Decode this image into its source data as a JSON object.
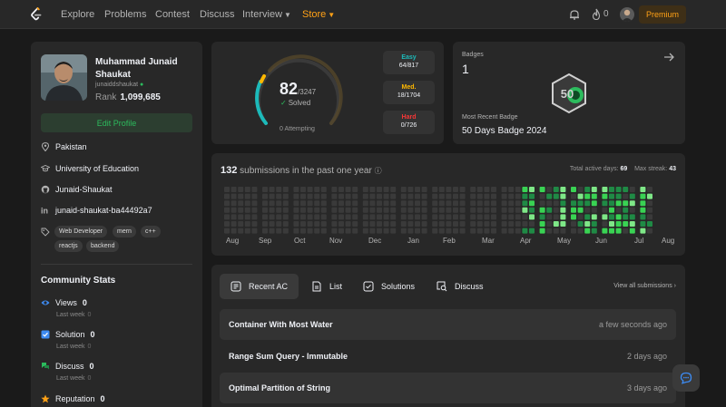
{
  "nav": {
    "items": [
      "Explore",
      "Problems",
      "Contest",
      "Discuss",
      "Interview",
      "Store"
    ],
    "streak": "0",
    "premium": "Premium"
  },
  "profile": {
    "name": "Muhammad Junaid Shaukat",
    "username": "junaiddshaukat",
    "rank_label": "Rank",
    "rank": "1,099,685",
    "edit_label": "Edit Profile",
    "location": "Pakistan",
    "school": "University of Education",
    "github": "Junaid-Shaukat",
    "linkedin": "junaid-shaukat-ba44492a7",
    "tags": [
      "Web Developer",
      "mern",
      "c++",
      "reactjs",
      "backend"
    ]
  },
  "community": {
    "title": "Community Stats",
    "stats": [
      {
        "label": "Views",
        "value": "0",
        "sub": "Last week",
        "sub_val": "0"
      },
      {
        "label": "Solution",
        "value": "0",
        "sub": "Last week",
        "sub_val": "0"
      },
      {
        "label": "Discuss",
        "value": "0",
        "sub": "Last week",
        "sub_val": "0"
      },
      {
        "label": "Reputation",
        "value": "0"
      }
    ]
  },
  "progress": {
    "solved": "82",
    "total": "/3247",
    "solved_label": "Solved",
    "attempting": "0 Attempting",
    "easy": {
      "label": "Easy",
      "count": "64/817",
      "color": "#1cbaba"
    },
    "medium": {
      "label": "Med.",
      "count": "18/1704",
      "color": "#ffb800"
    },
    "hard": {
      "label": "Hard",
      "count": "0/726",
      "color": "#f63737"
    }
  },
  "badges": {
    "label": "Badges",
    "count": "1",
    "recent_label": "Most Recent Badge",
    "recent": "50 Days Badge 2024",
    "badge_text": "50"
  },
  "submissions": {
    "count": "132",
    "title_rest": "submissions in the past one year",
    "active_label": "Total active days:",
    "active": "69",
    "streak_label": "Max streak:",
    "streak": "43",
    "months": [
      "Aug",
      "Sep",
      "Oct",
      "Nov",
      "Dec",
      "Jan",
      "Feb",
      "Mar",
      "Apr",
      "May",
      "Jun",
      "Jul",
      "Aug"
    ]
  },
  "recent": {
    "tabs": [
      "Recent AC",
      "List",
      "Solutions",
      "Discuss"
    ],
    "view_all": "View all submissions",
    "rows": [
      {
        "title": "Container With Most Water",
        "date": "a few seconds ago"
      },
      {
        "title": "Range Sum Query - Immutable",
        "date": "2 days ago"
      },
      {
        "title": "Optimal Partition of String",
        "date": "3 days ago"
      }
    ]
  },
  "colors": {
    "accent": "#ffa116",
    "green": "#2cbb5d"
  }
}
